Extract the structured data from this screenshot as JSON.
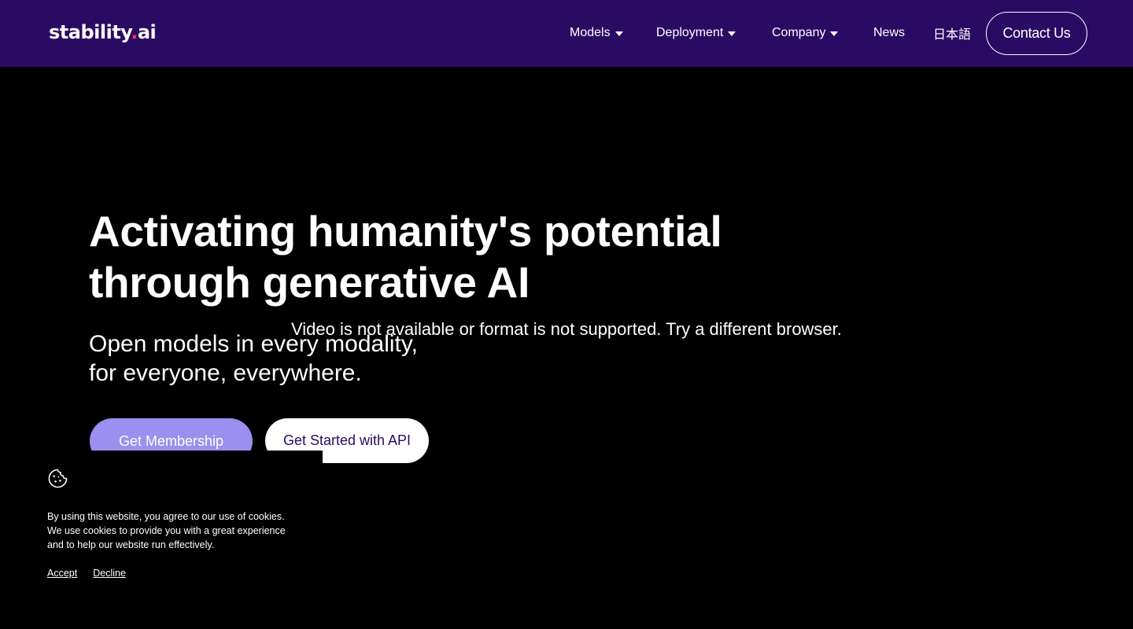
{
  "header": {
    "logo_text": "stability",
    "logo_dot": ".",
    "logo_suffix": "ai",
    "nav": [
      {
        "label": "Models",
        "has_dropdown": true
      },
      {
        "label": "Deployment",
        "has_dropdown": true
      },
      {
        "label": "Company",
        "has_dropdown": true
      },
      {
        "label": "News",
        "has_dropdown": false
      },
      {
        "label": "日本語",
        "has_dropdown": false
      }
    ],
    "contact_label": "Contact Us",
    "background_color": "#2a0b63"
  },
  "hero": {
    "title_line1": "Activating humanity's potential",
    "title_line2": "through generative AI",
    "subtitle_line1": "Open models in every modality,",
    "subtitle_line2": "for everyone, everywhere.",
    "video_message": "Video is not available or format is not supported. Try a different browser.",
    "primary_button": "Get Membership",
    "secondary_button": "Get Started with API",
    "primary_button_color": "#9b8ff0"
  },
  "cookie_banner": {
    "icon": "cookie-icon",
    "text_line1": "By using this website, you agree to our use of cookies.",
    "text_line2": "We use cookies to provide you with a great experience",
    "text_line3": "and to help our website run effectively.",
    "accept_label": "Accept",
    "decline_label": "Decline"
  }
}
